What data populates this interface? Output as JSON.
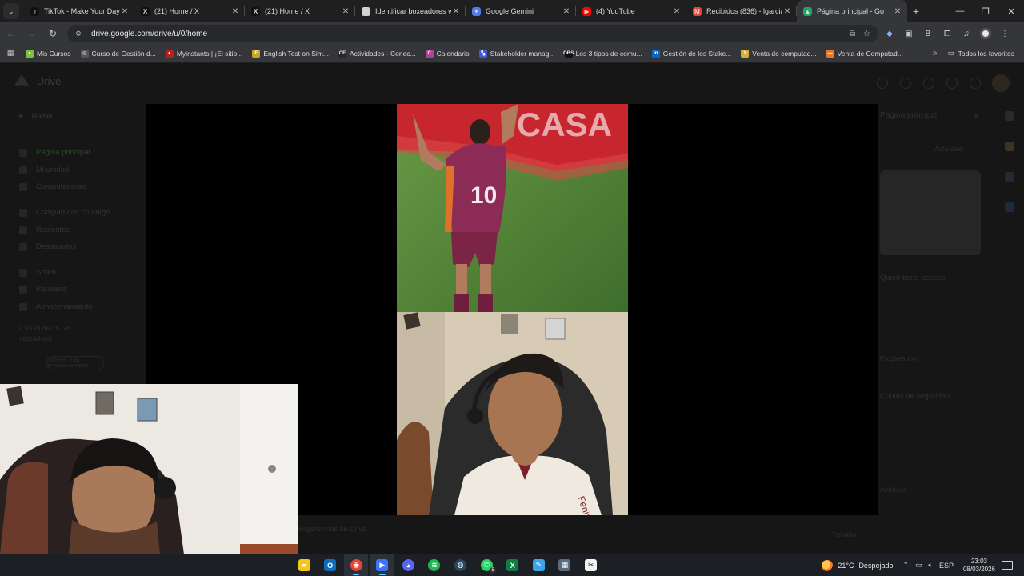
{
  "browser": {
    "tabs": [
      {
        "title": "TikTok - Make Your Day",
        "icon": "tiktok-icon",
        "fav_color": "#111111",
        "fav_text": "♪"
      },
      {
        "title": "(21) Home / X",
        "icon": "x-icon",
        "fav_color": "#111111",
        "fav_text": "X"
      },
      {
        "title": "(21) Home / X",
        "icon": "x-icon",
        "fav_color": "#111111",
        "fav_text": "X"
      },
      {
        "title": "Identificar boxeadores ve",
        "icon": "document-icon",
        "fav_color": "#d0d0d0",
        "fav_text": "▣"
      },
      {
        "title": "Google Gemini",
        "icon": "gemini-icon",
        "fav_color": "#4f7bf0",
        "fav_text": "✦"
      },
      {
        "title": "(4) YouTube",
        "icon": "youtube-icon",
        "fav_color": "#ff0000",
        "fav_text": "▶"
      },
      {
        "title": "Recibidos (836) - lgarciad",
        "icon": "gmail-icon",
        "fav_color": "#ea4335",
        "fav_text": "M"
      },
      {
        "title": "Página principal - Go",
        "icon": "drive-icon",
        "fav_color": "#1fa463",
        "fav_text": "▲",
        "active": true
      }
    ],
    "url": "drive.google.com/drive/u/0/home",
    "bookmarks": [
      {
        "label": "Mis Cursos",
        "color": "#7bc043",
        "text": "●"
      },
      {
        "label": "Curso de Gestión d...",
        "color": "#555555",
        "text": "◎"
      },
      {
        "label": "Myinstants | ¡El sitio...",
        "color": "#b22222",
        "text": "●"
      },
      {
        "label": "English Test on Sim...",
        "color": "#c9a227",
        "text": "E"
      },
      {
        "label": "Actividades - Conec...",
        "color": "#2a2a2a",
        "text": "CE"
      },
      {
        "label": "Calendario",
        "color": "#b0409a",
        "text": "C"
      },
      {
        "label": "Stakeholder manag...",
        "color": "#3b5bdb",
        "text": "▚"
      },
      {
        "label": "Los 3 tipos de comu...",
        "color": "#111111",
        "text": "OBS"
      },
      {
        "label": "Gestión de los Stake...",
        "color": "#0a66c2",
        "text": "in"
      },
      {
        "label": "Venta de computad...",
        "color": "#d4b13a",
        "text": "Y"
      },
      {
        "label": "Venta de Computad...",
        "color": "#e8742f",
        "text": "▬"
      }
    ],
    "all_bookmarks": "Todos los favoritos"
  },
  "drive": {
    "app_name": "Drive",
    "new_button": "Nuevo",
    "nav": [
      {
        "label": "Página principal",
        "selected": true
      },
      {
        "label": "Mi unidad"
      },
      {
        "label": "Computadoras"
      },
      {
        "label": "Compartidos conmigo"
      },
      {
        "label": "Recientes"
      },
      {
        "label": "Destacados"
      },
      {
        "label": "Spam"
      },
      {
        "label": "Papelera"
      },
      {
        "label": "Almacenamiento"
      }
    ],
    "storage_used": "4,9 GB de 15 GB",
    "storage_sub": "utilizado(s)",
    "storage_button": "Obtener más almacenamiento",
    "panel_title": "Página principal",
    "panel_tab": "Actividad",
    "panel_access": "Quién tiene acceso",
    "panel_owners": "Propietarios",
    "panel_security": "Copias de seguridad",
    "panel_files": "Archivos",
    "panel_size": "Tamaño",
    "bottom_text": "Sugerencias de Drive"
  },
  "taskbar": {
    "apps": [
      {
        "name": "file-explorer-icon",
        "color": "#f5c518",
        "text": "▰"
      },
      {
        "name": "outlook-icon",
        "color": "#0f6cbd",
        "text": "O"
      },
      {
        "name": "chrome-icon",
        "color": "#ea4335",
        "text": "◉",
        "active": true,
        "round": true
      },
      {
        "name": "obs-studio-icon",
        "color": "#3b73ff",
        "text": "▶",
        "active": true
      },
      {
        "name": "discord-icon",
        "color": "#5865f2",
        "text": "◕",
        "round": true
      },
      {
        "name": "spotify-icon",
        "color": "#1db954",
        "text": "≋",
        "round": true
      },
      {
        "name": "steam-icon",
        "color": "#2a475e",
        "text": "◍",
        "round": true
      },
      {
        "name": "whatsapp-icon",
        "color": "#25d366",
        "text": "✆",
        "round": true,
        "badge": "5"
      },
      {
        "name": "excel-icon",
        "color": "#107c41",
        "text": "X"
      },
      {
        "name": "paint-icon",
        "color": "#3ba3e8",
        "text": "✎"
      },
      {
        "name": "calculator-icon",
        "color": "#5a6b80",
        "text": "▦"
      },
      {
        "name": "capcut-icon",
        "color": "#f2f2f2",
        "text": "✂"
      }
    ],
    "weather_temp": "21°C",
    "weather_text": "Despejado",
    "language": "ESP",
    "time": "23:03",
    "date": "08/03/2026"
  },
  "video": {
    "jersey_number": "10",
    "banner_text": "CASA"
  }
}
